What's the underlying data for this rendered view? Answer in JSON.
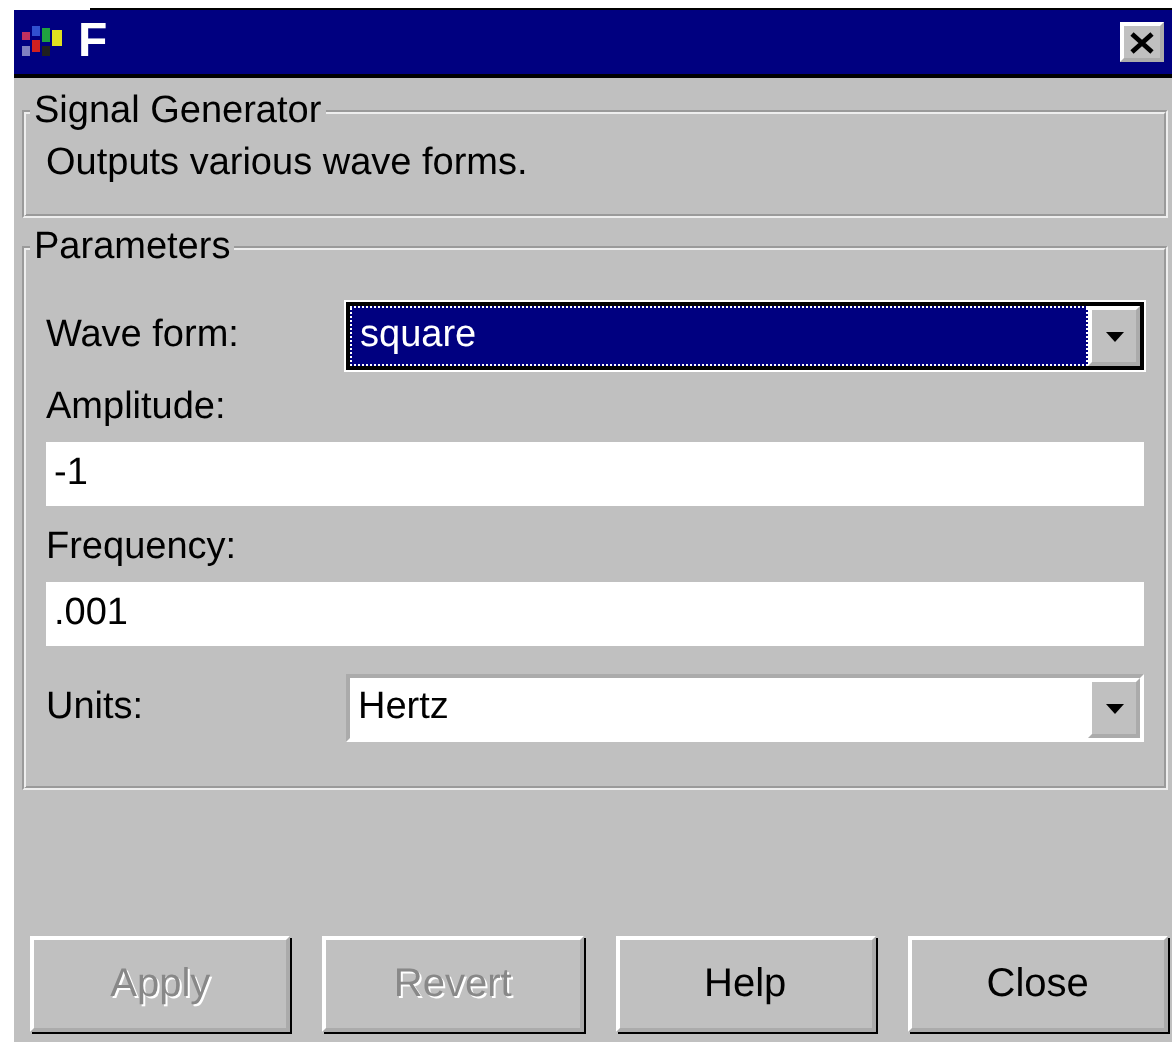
{
  "window": {
    "title": "F"
  },
  "groups": [
    {
      "title": "Signal Generator",
      "description": "Outputs various wave forms."
    },
    {
      "title": "Parameters",
      "fields": [
        {
          "kind": "combo",
          "label": "Wave form:",
          "value": "square",
          "focused": true
        },
        {
          "kind": "text",
          "label": "Amplitude:",
          "value": "-1"
        },
        {
          "kind": "text",
          "label": "Frequency:",
          "value": ".001"
        },
        {
          "kind": "combo",
          "label": "Units:",
          "value": "Hertz",
          "focused": false
        }
      ]
    }
  ],
  "buttons": [
    {
      "label": "Apply",
      "disabled": true
    },
    {
      "label": "Revert",
      "disabled": true
    },
    {
      "label": "Help",
      "disabled": false
    },
    {
      "label": "Close",
      "disabled": false
    }
  ]
}
